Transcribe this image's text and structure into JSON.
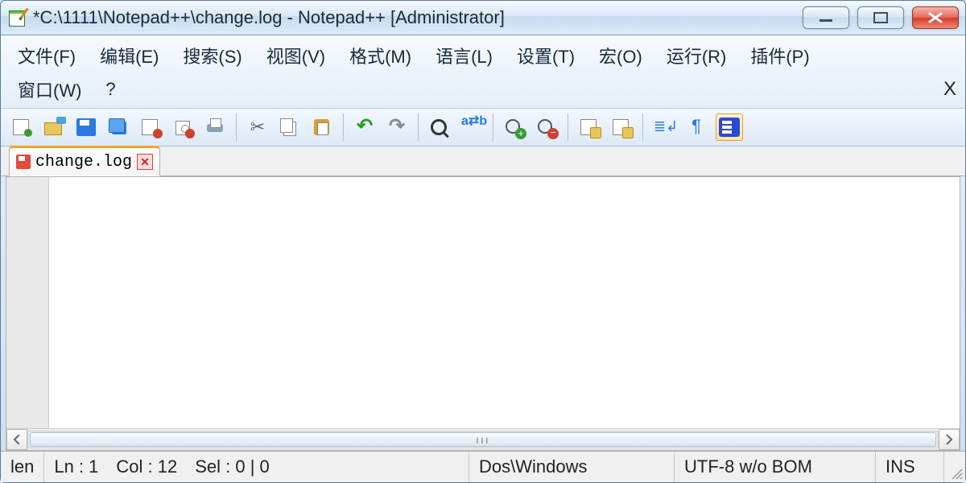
{
  "title": "*C:\\1111\\Notepad++\\change.log - Notepad++ [Administrator]",
  "menu": {
    "row1": [
      "文件(F)",
      "编辑(E)",
      "搜索(S)",
      "视图(V)",
      "格式(M)",
      "语言(L)",
      "设置(T)",
      "宏(O)",
      "运行(R)",
      "插件(P)"
    ],
    "row2": [
      "窗口(W)",
      "?"
    ],
    "close_glyph": "X"
  },
  "toolbar": [
    {
      "name": "new-file-icon",
      "kind": "new"
    },
    {
      "name": "open-file-icon",
      "kind": "open"
    },
    {
      "name": "save-icon",
      "kind": "save"
    },
    {
      "name": "save-all-icon",
      "kind": "saveall"
    },
    {
      "name": "close-file-icon",
      "kind": "close"
    },
    {
      "name": "close-all-icon",
      "kind": "closeall"
    },
    {
      "name": "print-icon",
      "kind": "print"
    },
    {
      "sep": true
    },
    {
      "name": "cut-icon",
      "kind": "cut",
      "glyph": "✂"
    },
    {
      "name": "copy-icon",
      "kind": "copy"
    },
    {
      "name": "paste-icon",
      "kind": "paste"
    },
    {
      "sep": true
    },
    {
      "name": "undo-icon",
      "kind": "undo",
      "glyph": "↶"
    },
    {
      "name": "redo-icon",
      "kind": "redo",
      "glyph": "↷"
    },
    {
      "sep": true
    },
    {
      "name": "find-icon",
      "kind": "find"
    },
    {
      "name": "replace-icon",
      "kind": "replace",
      "glyph": "a⇄b"
    },
    {
      "sep": true
    },
    {
      "name": "zoom-in-icon",
      "kind": "zoomin"
    },
    {
      "name": "zoom-out-icon",
      "kind": "zoomout"
    },
    {
      "sep": true
    },
    {
      "name": "sync-v-icon",
      "kind": "sync"
    },
    {
      "name": "sync-h-icon",
      "kind": "sync"
    },
    {
      "sep": true
    },
    {
      "name": "word-wrap-icon",
      "kind": "wrap",
      "glyph": "≣↲"
    },
    {
      "name": "show-symbols-icon",
      "kind": "para",
      "glyph": "¶"
    },
    {
      "name": "function-list-icon",
      "kind": "func",
      "active": true
    }
  ],
  "tab": {
    "label": "change.log",
    "modified": true
  },
  "scrollbar_thumb_glyph": "ııı",
  "status": {
    "len_label": "len",
    "ln": "Ln : 1",
    "col": "Col : 12",
    "sel": "Sel : 0 | 0",
    "eol": "Dos\\Windows",
    "encoding": "UTF-8 w/o BOM",
    "mode": "INS"
  }
}
